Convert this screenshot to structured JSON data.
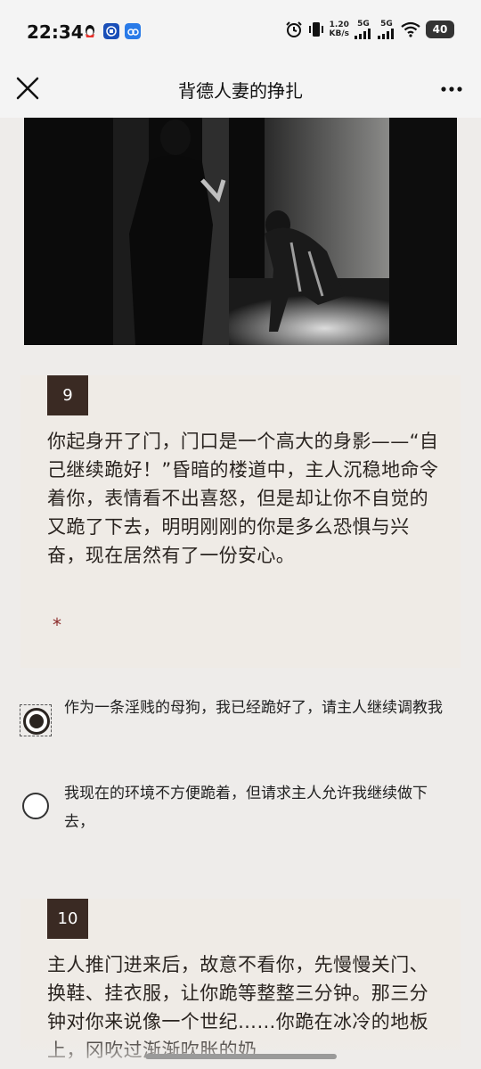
{
  "status_bar": {
    "time": "22:34",
    "speed_value": "1.20",
    "speed_unit": "KB/s",
    "net1": "5G",
    "net2": "5G",
    "battery": "40"
  },
  "nav": {
    "title": "背德人妻的挣扎"
  },
  "questions": [
    {
      "number": "9",
      "text": "你起身开了门，门口是一个高大的身影——“自己继续跪好！”昏暗的楼道中，主人沉稳地命令着你，表情看不出喜怒，但是却让你不自觉的又跪了下去，明明刚刚的你是多么恐惧与兴奋，现在居然有了一份安心。",
      "required_mark": "*",
      "options": [
        {
          "label": "作为一条淫贱的母狗，我已经跪好了，请主人继续调教我",
          "selected": true
        },
        {
          "label": "我现在的环境不方便跪着，但请求主人允许我继续做下去，",
          "selected": false
        }
      ]
    },
    {
      "number": "10",
      "text": "主人推门进来后，故意不看你，先慢慢关门、换鞋、挂衣服，让你跪等整整三分钟。那三分钟对你来说像一个世纪……你跪在冰冷的地板上，冈吹过渐渐吹胀的奶"
    }
  ],
  "icons": {
    "close": "close-icon",
    "more": "more-icon"
  }
}
